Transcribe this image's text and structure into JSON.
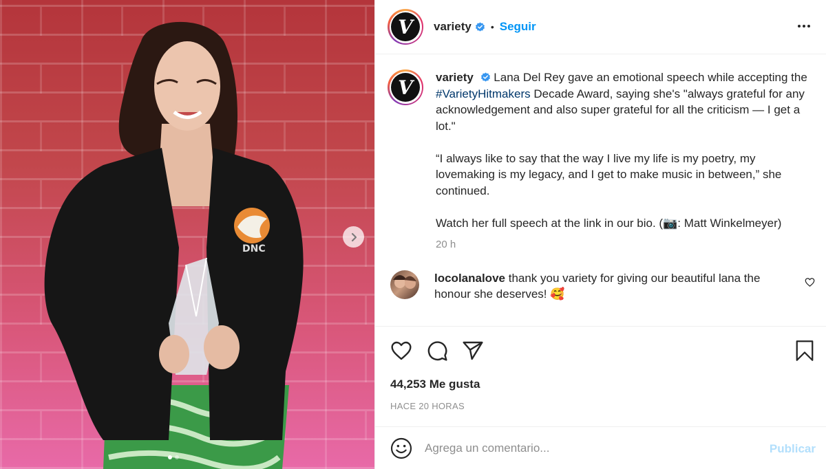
{
  "header": {
    "username": "variety",
    "separator": "•",
    "follow_label": "Seguir",
    "avatar_letter": "V"
  },
  "caption": {
    "username": "variety",
    "text_before_hashtag": "Lana Del Rey gave an emotional speech while accepting the ",
    "hashtag": "#VarietyHitmakers",
    "text_after_hashtag": " Decade Award, saying she's \"always grateful for any acknowledgement and also super grateful for all the criticism — I get a lot.\"",
    "paragraph2": "“I always like to say that the way I live my life is my poetry, my lovemaking is my legacy, and I get to make music in between,” she continued.",
    "paragraph3": "Watch her full speech at the link in our bio. (📷: Matt Winkelmeyer)",
    "time": "20 h"
  },
  "comment": {
    "username": "locolanalove",
    "text": "thank you variety for giving our beautiful lana the honour she deserves! 🥰"
  },
  "actions": {
    "icons": [
      "heart-icon",
      "comment-icon",
      "share-icon",
      "bookmark-icon"
    ]
  },
  "likes_text": "44,253 Me gusta",
  "posted_ago": "HACE 20 HORAS",
  "add_comment": {
    "placeholder": "Agrega un comentario...",
    "publish_label": "Publicar"
  },
  "carousel": {
    "slide_count": 2,
    "active_slide": 1
  },
  "colors": {
    "link_blue": "#0095f6",
    "hashtag_blue": "#00376b",
    "publish_disabled": "#b2dffc",
    "verified_blue": "#3897f0"
  }
}
